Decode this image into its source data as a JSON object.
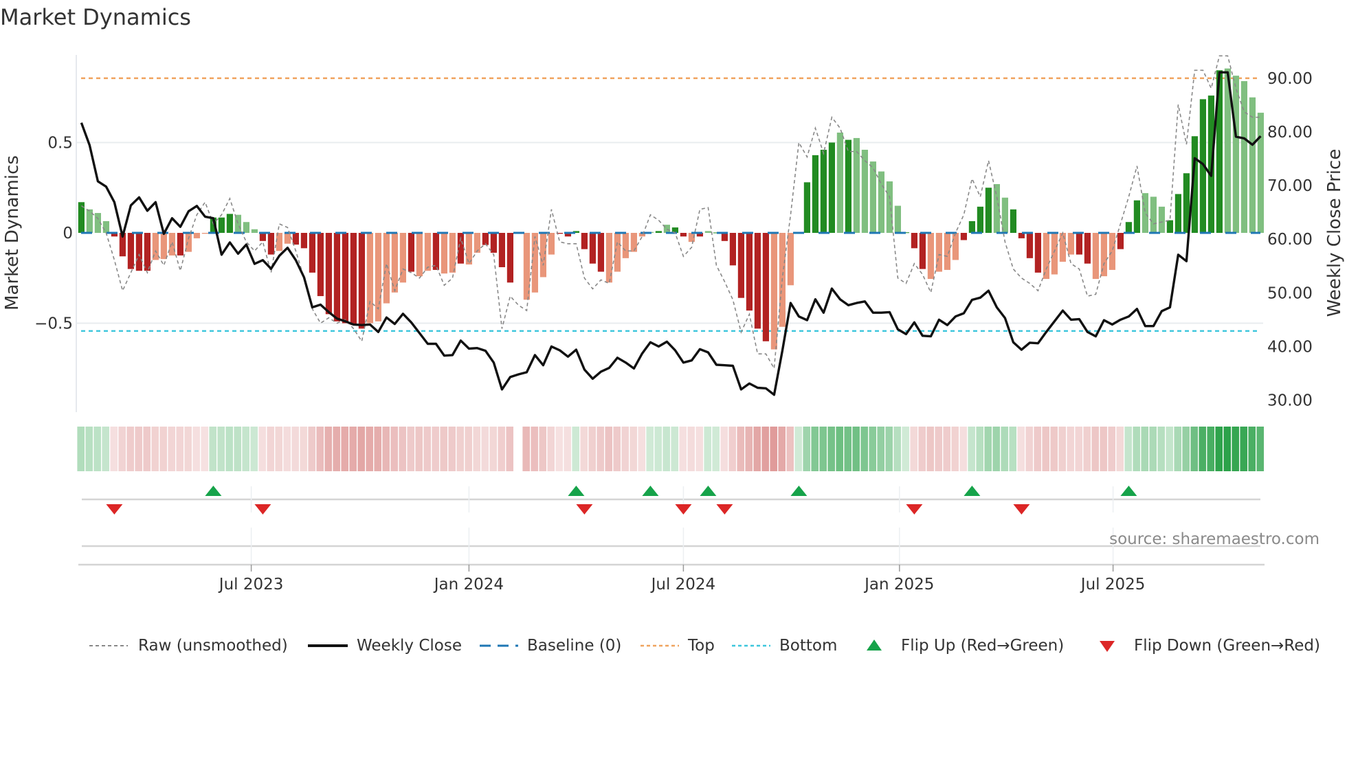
{
  "title": "Market Dynamics",
  "source": "source: sharemaestro.com",
  "legend": [
    {
      "label": "Raw (unsmoothed)",
      "key": "raw"
    },
    {
      "label": "Weekly Close",
      "key": "close"
    },
    {
      "label": "Baseline (0)",
      "key": "baseline"
    },
    {
      "label": "Top",
      "key": "top"
    },
    {
      "label": "Bottom",
      "key": "bottom"
    },
    {
      "label": "Flip Up (Red→Green)",
      "key": "flip_up"
    },
    {
      "label": "Flip Down (Green→Red)",
      "key": "flip_down"
    }
  ],
  "colors": {
    "strong_green": "#228b22",
    "weak_green": "#80bf80",
    "strong_red": "#b22222",
    "weak_red": "#e9967a",
    "raw": "#888888",
    "close": "#111111",
    "baseline": "#1f77b4",
    "top": "#f0a35e",
    "bottom": "#3cc6dc",
    "flip_up": "#16a34a",
    "flip_down": "#dc2626",
    "grid": "#e9ecef"
  },
  "chart_data": {
    "type": "bar",
    "title": "Market Dynamics",
    "ylabel": "Market Dynamics",
    "y2label": "Weekly Close Price",
    "ylim": [
      -1.0,
      0.98
    ],
    "y2lim": [
      27.3,
      95
    ],
    "yticks": [
      {
        "v": 0.5,
        "label": "0.5"
      },
      {
        "v": 0,
        "label": "0"
      },
      {
        "v": -0.5,
        "label": "−0.5"
      }
    ],
    "y2ticks": [
      {
        "v": 90,
        "label": "90.00"
      },
      {
        "v": 80,
        "label": "80.00"
      },
      {
        "v": 70,
        "label": "70.00"
      },
      {
        "v": 60,
        "label": "60.00"
      },
      {
        "v": 50,
        "label": "50.00"
      },
      {
        "v": 40,
        "label": "40.00"
      },
      {
        "v": 30,
        "label": "30.00"
      }
    ],
    "xticks": [
      {
        "week": 20.6,
        "label": "Jul 2023"
      },
      {
        "week": 47.0,
        "label": "Jan 2024"
      },
      {
        "week": 73.0,
        "label": "Jul 2024"
      },
      {
        "week": 99.2,
        "label": "Jan 2025"
      },
      {
        "week": 125.1,
        "label": "Jul 2025"
      }
    ],
    "top_level": 0.856,
    "bottom_level": -0.543,
    "bars": [
      0.17,
      0.13,
      0.11,
      0.065,
      -0.02,
      -0.13,
      -0.2,
      -0.21,
      -0.21,
      -0.15,
      -0.145,
      -0.125,
      -0.125,
      -0.105,
      -0.03,
      -0.005,
      0.085,
      0.085,
      0.105,
      0.1,
      0.06,
      0.02,
      -0.045,
      -0.12,
      -0.1,
      -0.06,
      -0.065,
      -0.085,
      -0.22,
      -0.35,
      -0.45,
      -0.49,
      -0.5,
      -0.51,
      -0.53,
      -0.5,
      -0.49,
      -0.39,
      -0.33,
      -0.275,
      -0.215,
      -0.24,
      -0.21,
      -0.205,
      -0.225,
      -0.22,
      -0.17,
      -0.175,
      -0.11,
      -0.067,
      -0.11,
      -0.19,
      -0.275,
      null,
      -0.37,
      -0.33,
      -0.245,
      -0.12,
      -0.005,
      -0.02,
      0.01,
      -0.09,
      -0.17,
      -0.215,
      -0.275,
      -0.215,
      -0.14,
      -0.105,
      -0.02,
      0.005,
      0.01,
      0.045,
      0.03,
      -0.02,
      -0.05,
      -0.02,
      0.01,
      0.002,
      -0.045,
      -0.18,
      -0.36,
      -0.43,
      -0.53,
      -0.6,
      -0.645,
      -0.52,
      -0.29,
      0.005,
      0.28,
      0.43,
      0.46,
      0.5,
      0.555,
      0.515,
      0.525,
      0.46,
      0.395,
      0.34,
      0.285,
      0.15,
      0.003,
      -0.085,
      -0.2,
      -0.255,
      -0.215,
      -0.205,
      -0.15,
      -0.04,
      0.065,
      0.145,
      0.25,
      0.27,
      0.195,
      0.13,
      -0.03,
      -0.14,
      -0.22,
      -0.255,
      -0.23,
      -0.16,
      -0.12,
      -0.12,
      -0.17,
      -0.255,
      -0.24,
      -0.205,
      -0.09,
      0.06,
      0.18,
      0.22,
      0.2,
      0.145,
      0.07,
      0.215,
      0.33,
      0.535,
      0.74,
      0.76,
      0.9,
      0.91,
      0.87,
      0.84,
      0.75,
      0.665
    ],
    "strong": "DLLLDDDDDLLLDLLLDDDLLLDDLLDDDDDDDDDLLLLLDLLDLLDLLDDDDDLLLLDDDDDDLLLLLLDLDDLDLDDDDDDDLLLDDDDDLDLLLLLLDDDLLLLDDDDLLDDDDLLLLDDLLLDDDLLLDDDDDDDLLLL",
    "raw": [
      0.15,
      0.12,
      0.08,
      0.0,
      -0.15,
      -0.32,
      -0.22,
      -0.12,
      -0.22,
      -0.1,
      -0.18,
      -0.05,
      -0.21,
      -0.03,
      0.1,
      0.17,
      0.05,
      0.1,
      0.19,
      0.05,
      -0.05,
      -0.1,
      -0.05,
      -0.22,
      0.05,
      0.03,
      -0.1,
      -0.25,
      -0.42,
      -0.5,
      -0.47,
      -0.5,
      -0.48,
      -0.53,
      -0.6,
      -0.38,
      -0.42,
      -0.17,
      -0.32,
      -0.2,
      -0.22,
      -0.25,
      -0.19,
      -0.18,
      -0.29,
      -0.25,
      -0.03,
      -0.17,
      -0.1,
      -0.06,
      -0.12,
      -0.53,
      -0.35,
      -0.4,
      -0.43,
      -0.02,
      -0.18,
      0.13,
      -0.05,
      -0.06,
      -0.06,
      -0.25,
      -0.31,
      -0.26,
      -0.28,
      -0.05,
      -0.1,
      -0.1,
      -0.02,
      0.1,
      0.07,
      0.02,
      0.0,
      -0.13,
      -0.08,
      0.13,
      0.14,
      -0.18,
      -0.27,
      -0.37,
      -0.55,
      -0.45,
      -0.67,
      -0.67,
      -0.75,
      -0.25,
      0.1,
      0.5,
      0.42,
      0.58,
      0.44,
      0.64,
      0.58,
      0.45,
      0.45,
      0.4,
      0.36,
      0.27,
      0.2,
      -0.25,
      -0.28,
      -0.17,
      -0.23,
      -0.33,
      -0.12,
      -0.13,
      0.0,
      0.1,
      0.3,
      0.2,
      0.4,
      0.2,
      -0.05,
      -0.2,
      -0.25,
      -0.28,
      -0.32,
      -0.2,
      -0.1,
      0.0,
      -0.17,
      -0.2,
      -0.35,
      -0.34,
      -0.17,
      -0.1,
      0.05,
      0.2,
      0.37,
      0.11,
      0.05,
      0.06,
      0.07,
      0.71,
      0.49,
      0.9,
      0.9,
      0.8,
      0.98,
      0.98,
      0.8,
      0.67,
      0.64,
      0.64
    ],
    "close": [
      81.7,
      77.5,
      70.8,
      69.8,
      66.9,
      60.5,
      66.3,
      67.8,
      65.3,
      66.9,
      61.0,
      63.9,
      62.3,
      65.2,
      66.2,
      64.2,
      63.9,
      57.1,
      59.4,
      57.3,
      59.0,
      55.4,
      56.1,
      54.5,
      56.9,
      58.4,
      56.1,
      52.9,
      47.3,
      47.8,
      46.4,
      45.2,
      44.7,
      44.1,
      44.0,
      44.1,
      42.7,
      45.4,
      44.2,
      46.1,
      44.5,
      42.5,
      40.5,
      40.5,
      38.3,
      38.4,
      41.1,
      39.6,
      39.7,
      39.2,
      37.0,
      32.0,
      34.3,
      34.8,
      35.2,
      38.4,
      36.5,
      40.0,
      39.3,
      38.1,
      39.4,
      35.7,
      34.0,
      35.3,
      36.0,
      37.9,
      37.0,
      35.9,
      38.7,
      40.8,
      40.0,
      40.9,
      39.3,
      37.0,
      37.4,
      39.5,
      38.9,
      36.6,
      36.5,
      36.4,
      32.0,
      33.1,
      32.3,
      32.2,
      31.0,
      39.2,
      48.1,
      45.6,
      44.9,
      48.8,
      46.3,
      50.8,
      48.8,
      47.7,
      48.1,
      48.4,
      46.3,
      46.3,
      46.4,
      43.2,
      42.3,
      44.5,
      42.0,
      41.9,
      45.0,
      44.0,
      45.6,
      46.2,
      48.7,
      49.1,
      50.4,
      47.3,
      45.3,
      40.8,
      39.4,
      40.7,
      40.6,
      42.7,
      44.7,
      46.7,
      45.0,
      45.1,
      42.7,
      41.9,
      44.9,
      44.1,
      45.0,
      45.6,
      47.0,
      43.8,
      43.8,
      46.6,
      47.3,
      57.1,
      55.9,
      75.1,
      74.0,
      71.8,
      91.1,
      91.1,
      79.1,
      78.8,
      77.6,
      79.2
    ],
    "flip_up_weeks": [
      16,
      60,
      69,
      76,
      87,
      108,
      127
    ],
    "flip_down_weeks": [
      4,
      22,
      61,
      73,
      78,
      101,
      114
    ]
  }
}
